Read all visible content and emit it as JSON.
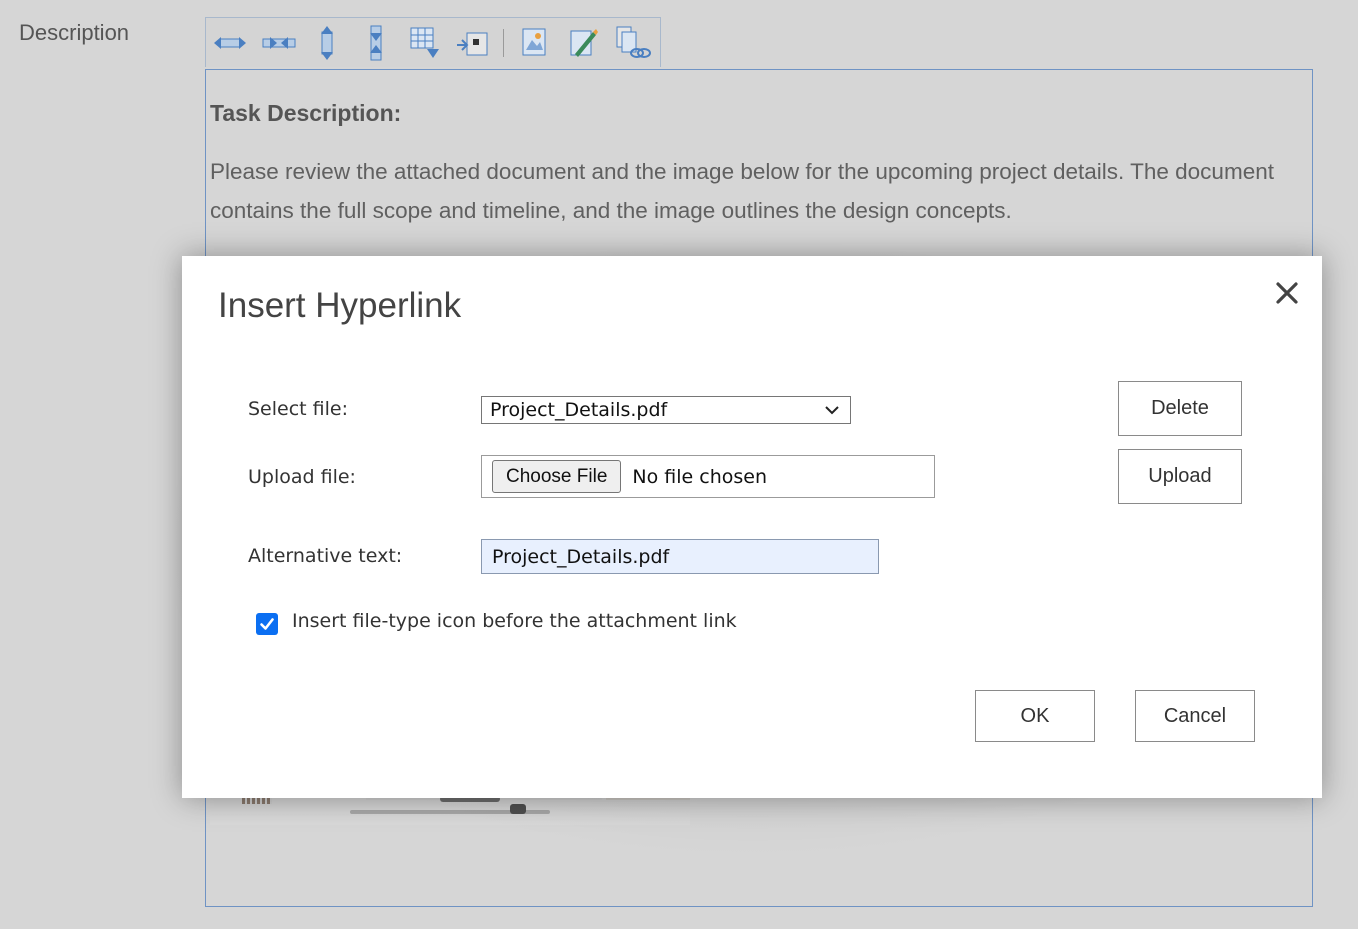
{
  "form": {
    "field_label": "Description"
  },
  "toolbar": {
    "buttons": [
      {
        "icon": "expand-horizontal-icon"
      },
      {
        "icon": "shrink-horizontal-icon"
      },
      {
        "icon": "expand-vertical-icon"
      },
      {
        "icon": "shrink-vertical-icon"
      },
      {
        "icon": "insert-table-row-icon"
      },
      {
        "icon": "insert-table-column-icon"
      },
      {
        "icon": "insert-image-icon"
      },
      {
        "icon": "edit-image-icon"
      },
      {
        "icon": "insert-attachment-link-icon"
      }
    ]
  },
  "editor": {
    "heading": "Task Description:",
    "body": "Please review the attached document and the image below for the upcoming project details. The document contains the full scope and timeline, and the image outlines the design concepts."
  },
  "dialog": {
    "title": "Insert Hyperlink",
    "close_icon": "close-icon",
    "select_file_label": "Select file:",
    "selected_file": "Project_Details.pdf",
    "upload_file_label": "Upload file:",
    "choose_file_label": "Choose File",
    "file_status": "No file chosen",
    "alt_text_label": "Alternative text:",
    "alt_text_value": "Project_Details.pdf",
    "checkbox_label": "Insert file-type icon before the attachment link",
    "checkbox_checked": true,
    "delete_label": "Delete",
    "upload_label": "Upload",
    "ok_label": "OK",
    "cancel_label": "Cancel"
  },
  "colors": {
    "accent": "#0b6ff2",
    "editor_border": "#6f93c4",
    "overlay_bg": "#d6d6d6",
    "icon_blue": "#4a7fc1"
  }
}
